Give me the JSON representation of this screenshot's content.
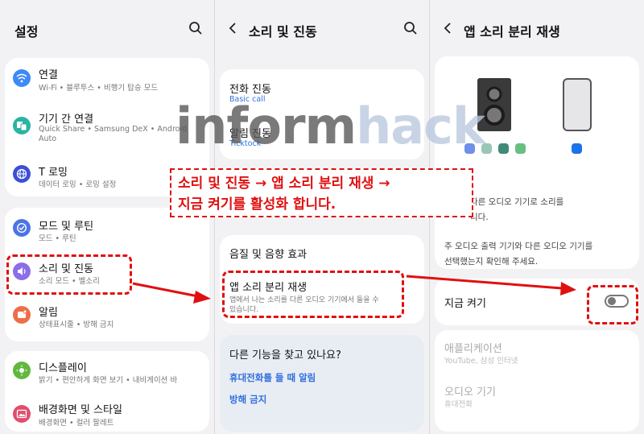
{
  "panel1": {
    "title": "설정",
    "items": [
      {
        "title": "연결",
        "subtitle": "Wi-Fi • 블루투스 • 비행기 탑승 모드",
        "icon": "wifi-icon",
        "color": "#3e8af5"
      },
      {
        "title": "기기 간 연결",
        "subtitle": "Quick Share • Samsung DeX • Android",
        "subtitle2": "Auto",
        "icon": "devices-icon",
        "color": "#2bb3a3"
      },
      {
        "title": "T 로밍",
        "subtitle": "데이터 로밍 • 로밍 설정",
        "icon": "globe-icon",
        "color": "#3b4fd6"
      },
      {
        "title": "모드 및 루틴",
        "subtitle": "모드 • 루틴",
        "icon": "check-circle-icon",
        "color": "#4d74e6"
      },
      {
        "title": "소리 및 진동",
        "subtitle": "소리 모드 • 벨소리",
        "icon": "speaker-icon",
        "color": "#8b6ee8"
      },
      {
        "title": "알림",
        "subtitle": "상태표시줄 • 방해 금지",
        "icon": "notification-icon",
        "color": "#ef6e48"
      },
      {
        "title": "디스플레이",
        "subtitle": "밝기 • 편안하게 화면 보기 • 내비게이션 바",
        "icon": "sun-icon",
        "color": "#62b83e"
      },
      {
        "title": "배경화면 및 스타일",
        "subtitle": "배경화면 • 컬러 팔레트",
        "icon": "image-icon",
        "color": "#e04e6e"
      }
    ]
  },
  "panel2": {
    "title": "소리 및 진동",
    "items": [
      {
        "title": "전화 진동",
        "subtitle": "Basic call"
      },
      {
        "title": "알림 진동",
        "subtitle": "Ticktock"
      },
      {
        "title": "음질 및 음향 효과"
      },
      {
        "title": "앱 소리 분리 재생",
        "subtitle": "앱에서 나는 소리를 다른 오디오 기기에서 들을 수",
        "subtitle2": "있습니다."
      }
    ],
    "suggest": {
      "title": "다른 기능을 찾고 있나요?",
      "links": [
        "휴대전화를 들 때 알림",
        "방해 금지"
      ]
    }
  },
  "panel3": {
    "title": "앱 소리 분리 재생",
    "desc1a": "다른 오디오 기기로 소리를",
    "desc1b": "니다.",
    "desc2a": "주 오디오 출력 기기와 다른 오디오 기기를",
    "desc2b": "선택했는지 확인해 주세요.",
    "toggle_label": "지금 켜기",
    "toggle_on": false,
    "app_label": "애플리케이션",
    "app_value": "YouTube, 삼성 인터넷",
    "audio_label": "오디오 기기",
    "audio_value": "휴대전화",
    "swatches_left": [
      "#6f8fe8",
      "#9ac6b8",
      "#3f8a78",
      "#66c080"
    ],
    "swatch_right": "#1a73e8"
  },
  "overlay": {
    "watermark_a": "inform",
    "watermark_b": "hack",
    "annot_line1": "소리 및 진동 → 앱 소리 분리 재생 →",
    "annot_line2": "지금 켜기를 활성화 합니다."
  }
}
